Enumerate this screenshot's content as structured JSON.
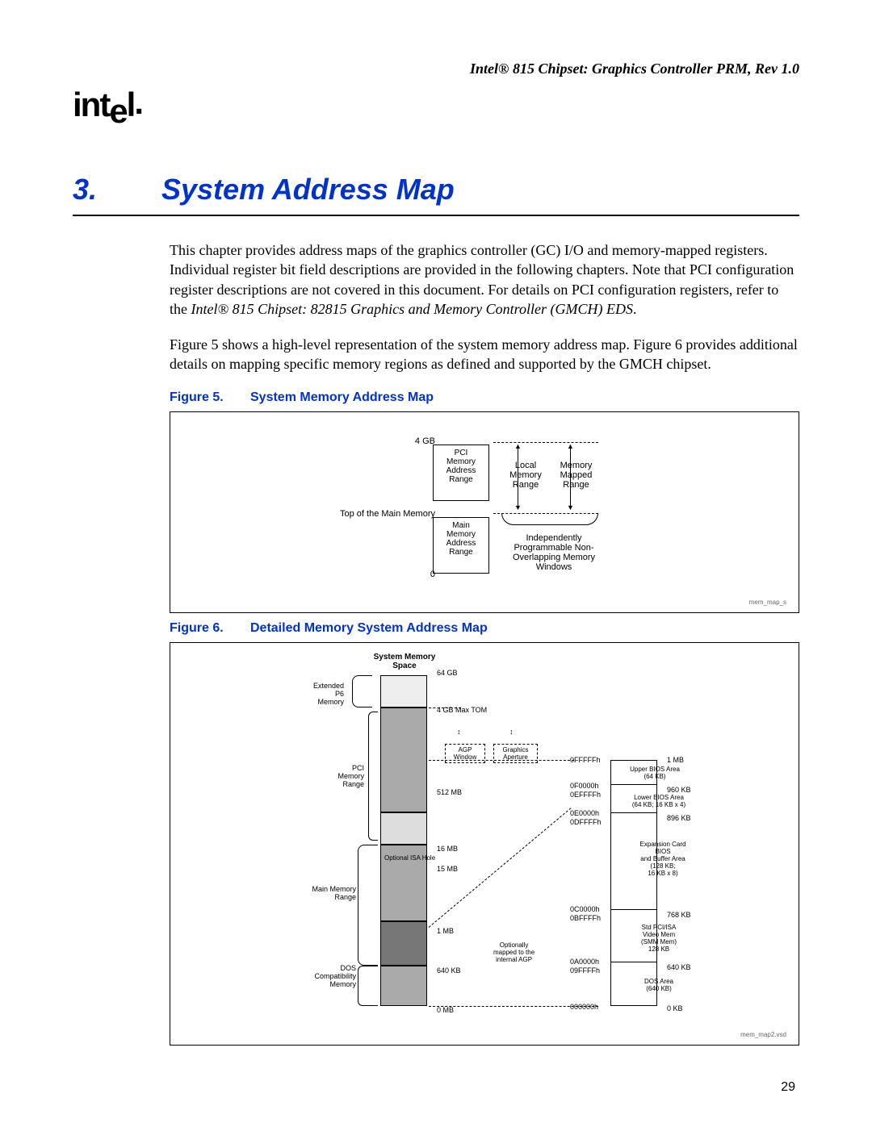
{
  "header": "Intel® 815 Chipset: Graphics Controller PRM, Rev 1.0",
  "logo": "intel",
  "chapter": {
    "num": "3.",
    "title": "System Address Map"
  },
  "para1_a": "This chapter provides address maps of the graphics controller (GC) I/O and memory-mapped registers. Individual register bit field descriptions are provided in the following chapters. Note that PCI configuration register descriptions are not covered in this document. For details on PCI configuration registers, refer to the ",
  "para1_ital": "Intel® 815 Chipset: 82815 Graphics and Memory Controller (GMCH) EDS",
  "para1_b": ".",
  "para2": "Figure 5 shows a high-level representation of the system memory address map. Figure 6 provides additional details on mapping specific memory regions as defined and supported by the GMCH chipset.",
  "fig5": {
    "num": "Figure 5.",
    "title": "System Memory Address Map",
    "lbl_4gb": "4 GB",
    "lbl_top": "Top of  the Main Memory",
    "lbl_0": "0",
    "box_pci": "PCI\nMemory\nAddress\nRange",
    "box_main": "Main\nMemory\nAddress\nRange",
    "lbl_local": "Local\nMemory\nRange",
    "lbl_mapped": "Memory\nMapped\nRange",
    "lbl_indep": "Independently\nProgrammable Non-\nOverlapping Memory\nWindows",
    "src": "mem_map_s"
  },
  "fig6": {
    "num": "Figure 6.",
    "title": "Detailed Memory System Address Map",
    "title_sys": "System Memory\nSpace",
    "lbl_64gb": "64 GB",
    "lbl_ext": "Extended\nP6\nMemory",
    "lbl_4gbmax": "4 GB Max TOM",
    "lbl_pci": "PCI\nMemory\nRange",
    "lbl_agp": "AGP\nWindow",
    "lbl_gfx": "Graphics\nAperture",
    "lbl_512": "512 MB",
    "lbl_16mb": "16 MB",
    "lbl_opt": "Optional ISA Hole",
    "lbl_15mb": "15 MB",
    "lbl_main": "Main Memory\nRange",
    "lbl_1mb": "1 MB",
    "lbl_640kb": "640 KB",
    "lbl_dos": "DOS\nCompatibility\nMemory",
    "lbl_0mb": "0 MB",
    "lbl_optmap": "Optionally\nmapped to the\ninternal AGP",
    "addr": {
      "a0FFFFF": "0FFFFFh",
      "a0F0000": "0F0000h",
      "a0EFFFF": "0EFFFFh",
      "a0E0000": "0E0000h",
      "a0DFFFF": "0DFFFFh",
      "a0C0000": "0C0000h",
      "a0BFFFF": "0BFFFFh",
      "a0A0000": "0A0000h",
      "a09FFFF": "09FFFFh",
      "a000000": "000000h"
    },
    "right": {
      "r1mb": "1 MB",
      "upper": "Upper BIOS Area\n(64 KB)",
      "r960": "960 KB",
      "lower": "Lower BIOS Area\n(64 KB; 16 KB x 4)",
      "r896": "896 KB",
      "exp": "Expansion Card\nBIOS\nand Buffer Area\n(128 KB;\n16 KB x 8)",
      "r768": "768 KB",
      "std": "Std PCI/ISA\nVideo Mem\n(SMM Mem)\n128 KB",
      "r640": "640 KB",
      "dos": "DOS Area\n(640 KB)",
      "r0": "0 KB"
    },
    "src": "mem_map2.vsd"
  },
  "pagenum": "29"
}
